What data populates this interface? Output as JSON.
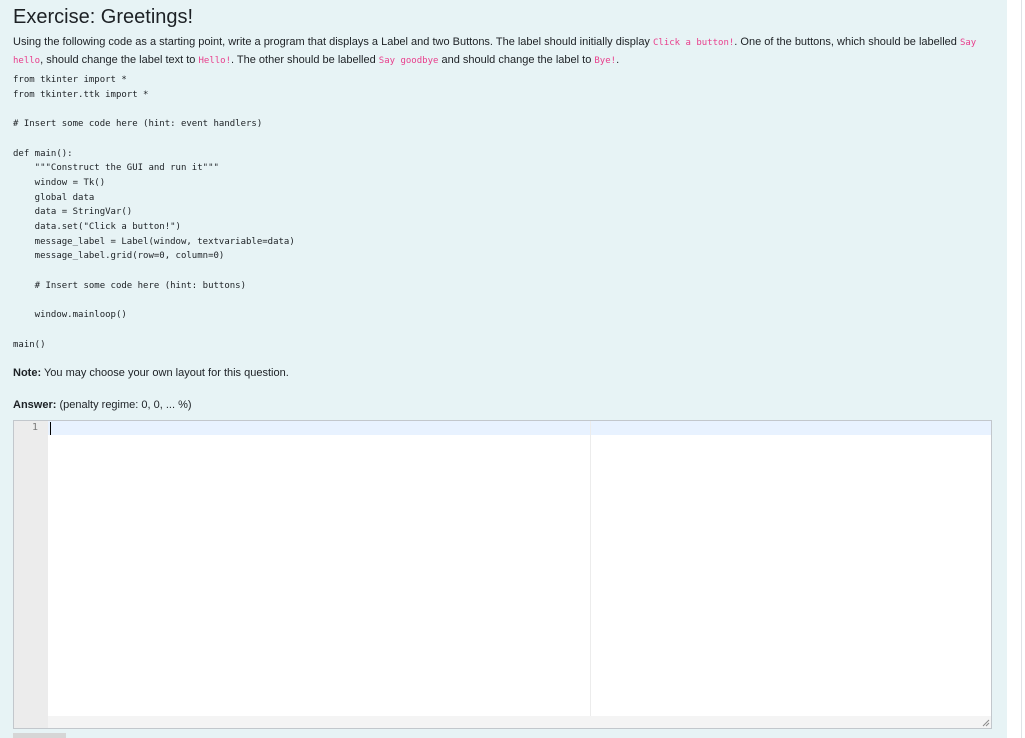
{
  "question": {
    "title": "Exercise: Greetings!",
    "description": {
      "p1": "Using the following code as a starting point, write a program that displays a Label and two Buttons. The label should initially display ",
      "c1": "Click a button!",
      "p2": ". One of the buttons, which should be labelled ",
      "c2": "Say hello",
      "p3": ", should change the label text to ",
      "c3": "Hello!",
      "p4": ". The other should be labelled ",
      "c4": "Say goodbye",
      "p5": " and should change the label to ",
      "c5": "Bye!",
      "p6": "."
    },
    "code": "from tkinter import *\nfrom tkinter.ttk import *\n\n# Insert some code here (hint: event handlers)\n\ndef main():\n    \"\"\"Construct the GUI and run it\"\"\"\n    window = Tk()\n    global data\n    data = StringVar()\n    data.set(\"Click a button!\")\n    message_label = Label(window, textvariable=data)\n    message_label.grid(row=0, column=0)\n\n    # Insert some code here (hint: buttons)\n\n    window.mainloop()\n\nmain()",
    "note_label": "Note:",
    "note_text": " You may choose your own layout for this question.",
    "answer_label": "Answer:",
    "penalty_text": " (penalty regime: 0, 0, ... %)"
  },
  "editor": {
    "line_number": "1",
    "content": ""
  }
}
